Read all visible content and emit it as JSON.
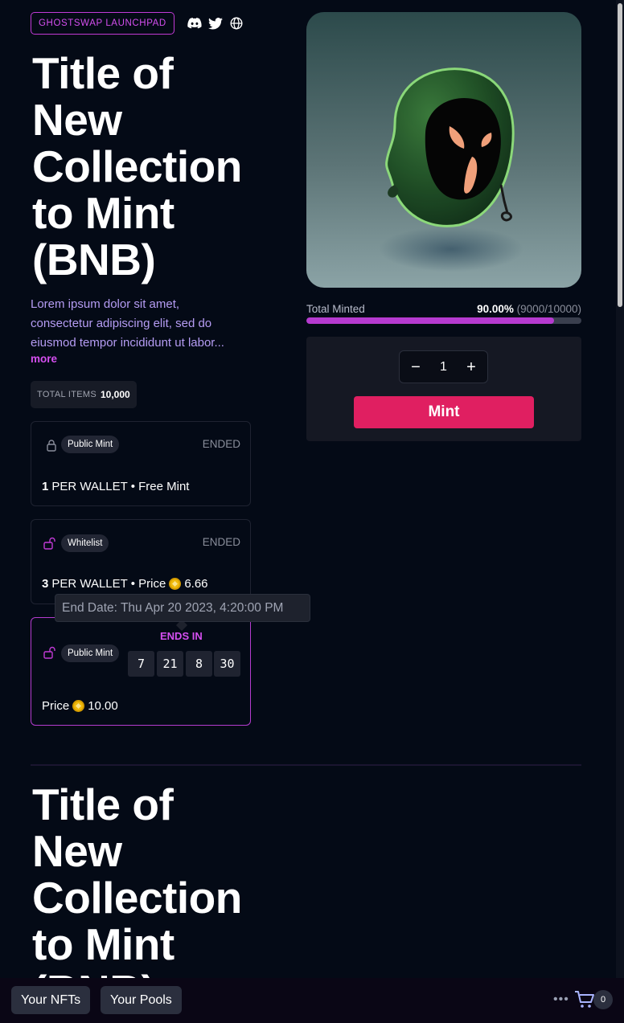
{
  "header": {
    "badge": "GHOSTSWAP LAUNCHPAD",
    "social_icons": [
      "discord-icon",
      "twitter-icon",
      "globe-icon"
    ]
  },
  "collection": {
    "title_lines": [
      "Title of",
      "New",
      "Collection",
      "to Mint",
      "(BNB)"
    ],
    "description_lines": [
      "Lorem ipsum dolor sit amet,",
      "consectetur adipiscing elit, sed do",
      "eiusmod tempor incididunt ut labor..."
    ],
    "more_label": "more",
    "total_items_label": "TOTAL ITEMS",
    "total_items_value": "10,000"
  },
  "phases": [
    {
      "pill": "Public Mint",
      "status": "ENDED",
      "icon": "lock-icon",
      "per_wallet_count": "1",
      "per_wallet_text": "PER WALLET • Free Mint"
    },
    {
      "pill": "Whitelist",
      "status": "ENDED",
      "icon": "unlock-icon",
      "per_wallet_count": "3",
      "per_wallet_text": "PER WALLET • Price",
      "price": "6.66"
    },
    {
      "pill": "Public Mint",
      "icon": "unlock-icon",
      "ends_in_label": "ENDS IN",
      "countdown": [
        "7",
        "21",
        "8",
        "30"
      ],
      "price_label": "Price",
      "price": "10.00"
    }
  ],
  "tooltip": "End Date: Thu Apr 20 2023, 4:20:00 PM",
  "minting": {
    "total_minted_label": "Total Minted",
    "percent_text": "90.00%",
    "count_text": "(9000/10000)",
    "progress_fraction": 0.9,
    "quantity": "1",
    "mint_label": "Mint"
  },
  "repeated_title_lines": [
    "Title of",
    "New",
    "Collection",
    "to Mint",
    "(BNB)"
  ],
  "bottom_bar": {
    "your_nfts": "Your NFTs",
    "your_pools": "Your Pools",
    "more_dots": "•••",
    "cart_count": "0"
  },
  "colors": {
    "background": "#040a16",
    "accent_purple": "#d54ff0",
    "mint_button": "#e01f61",
    "progress_fill": "#b63ad0"
  }
}
